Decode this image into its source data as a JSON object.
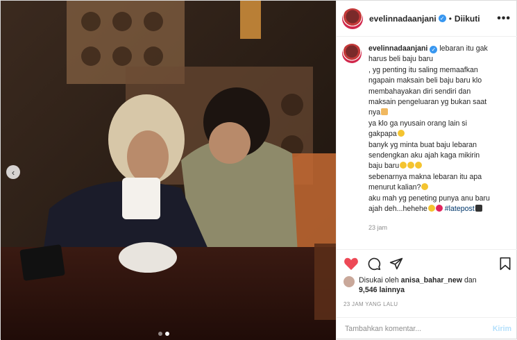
{
  "header": {
    "username": "evelinnadaanjani",
    "separator": "•",
    "follow_status": "Diikuti",
    "more": "•••"
  },
  "caption": {
    "username": "evelinnadaanjani",
    "lines": [
      "lebaran itu gak",
      "harus beli baju baru",
      ", yg penting itu saling memaafkan",
      "ngapain maksain beli baju baru klo",
      "membahayakan diri sendiri dan",
      "maksain pengeluaran yg bukan saat",
      "nya",
      "ya klo ga nyusain orang lain si",
      "gakpapa",
      "banyk yg minta buat baju lebaran",
      "sendengkan aku ajah kaga mikirin",
      "baju baru",
      "sebenarnya makna lebaran itu apa",
      "menurut kalian?",
      "aku mah yg peneting punya anu baru",
      "ajah deh...hehehe"
    ],
    "hashtag": "#latepost",
    "time_ago": "23 jam"
  },
  "likes": {
    "prefix": "Disukai oleh",
    "user": "anisa_bahar_new",
    "joiner": "dan",
    "count": "9,546 lainnya"
  },
  "post_time": "23 JAM YANG LALU",
  "comment": {
    "placeholder": "Tambahkan komentar...",
    "post_label": "Kirim"
  },
  "icons": {
    "like": "heart-icon",
    "comment": "comment-icon",
    "share": "share-icon",
    "save": "bookmark-icon",
    "verified": "verified-badge-icon",
    "prev": "chevron-left-icon"
  },
  "colors": {
    "like_active": "#ed4956",
    "verified": "#3897f0",
    "link": "#00376b",
    "post_button_disabled": "#b2dffc"
  },
  "carousel": {
    "total": 2,
    "active": 2
  }
}
